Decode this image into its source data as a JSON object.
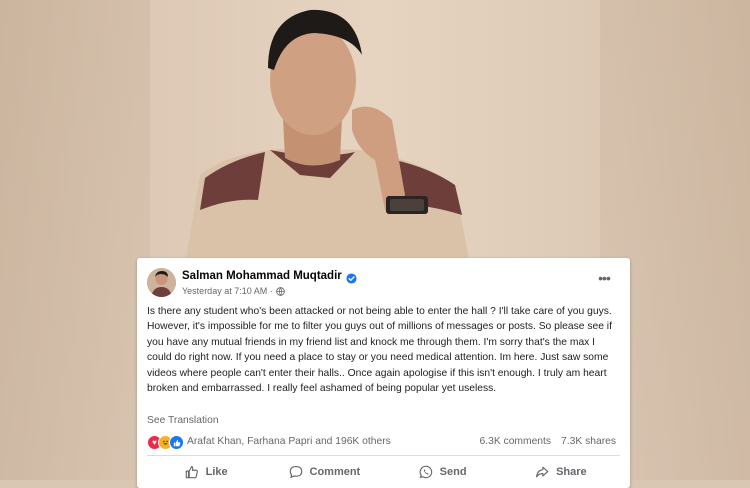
{
  "post": {
    "author": "Salman Mohammad Muqtadir",
    "timestamp": "Yesterday at 7:10 AM",
    "verified_icon": "verified-badge-icon",
    "audience_icon": "globe-icon",
    "more_label": "•••",
    "body": "Is there any student who's been attacked or not being able to enter the hall ? I'll take care of you guys. However, it's impossible for me to filter you guys out of millions of messages or posts. So please see if you have any mutual friends in my friend list and knock me through them. I'm sorry that's the max I could do right now. If you need a place to stay or you need medical attention. Im here. Just saw some videos where people can't enter their halls.. Once again apologise if this isn't enough. I truly am heart broken and embarrassed. I really feel ashamed of being popular yet useless.",
    "see_translation": "See Translation",
    "reactions": {
      "icons": [
        "love",
        "haha",
        "like"
      ],
      "summary": "Arafat Khan, Farhana Papri and 196K others",
      "comments": "6.3K comments",
      "shares": "7.3K shares"
    },
    "actions": {
      "like": "Like",
      "comment": "Comment",
      "send": "Send",
      "share": "Share"
    }
  },
  "colors": {
    "facebook_blue": "#1877f2",
    "text_secondary": "#65676b",
    "love_red": "#f0284a",
    "haha_yellow": "#f7b125"
  }
}
